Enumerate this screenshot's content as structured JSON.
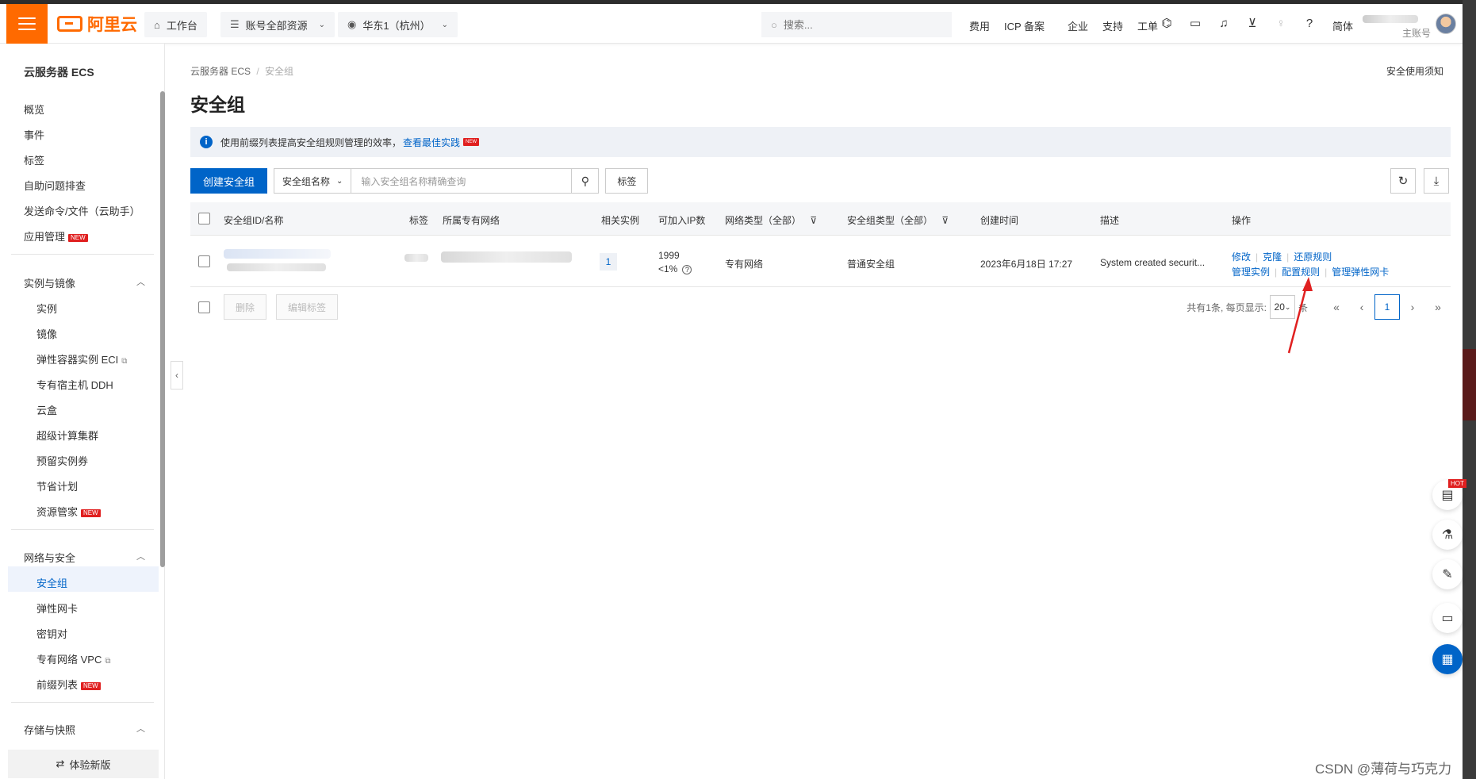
{
  "header": {
    "logo_text": "阿里云",
    "workbench": "工作台",
    "resources": "账号全部资源",
    "region": "华东1（杭州）",
    "search_placeholder": "搜索...",
    "nav": [
      "费用",
      "ICP 备案",
      "企业",
      "支持",
      "工单"
    ],
    "lang": "简体",
    "account_sub": "主账号"
  },
  "sidebar": {
    "title": "云服务器 ECS",
    "top_items": [
      "概览",
      "事件",
      "标签",
      "自助问题排查",
      "发送命令/文件（云助手）",
      "应用管理"
    ],
    "group1": {
      "label": "实例与镜像",
      "items": [
        "实例",
        "镜像",
        "弹性容器实例 ECI",
        "专有宿主机 DDH",
        "云盒",
        "超级计算集群",
        "预留实例券",
        "节省计划",
        "资源管家"
      ]
    },
    "group2": {
      "label": "网络与安全",
      "items": [
        "安全组",
        "弹性网卡",
        "密钥对",
        "专有网络 VPC",
        "前缀列表"
      ]
    },
    "group3": {
      "label": "存储与快照"
    },
    "new_badge": "NEW",
    "bottom": "体验新版"
  },
  "main": {
    "breadcrumb_root": "云服务器 ECS",
    "breadcrumb_sep": "/",
    "breadcrumb_current": "安全组",
    "notice_link": "安全使用须知",
    "title": "安全组",
    "info_text": "使用前缀列表提高安全组规则管理的效率，",
    "info_link": "查看最佳实践",
    "create_button": "创建安全组",
    "filter_select": "安全组名称",
    "filter_placeholder": "输入安全组名称精确查询",
    "tag_button": "标签",
    "columns": [
      "安全组ID/名称",
      "标签",
      "所属专有网络",
      "相关实例",
      "可加入IP数",
      "网络类型（全部）",
      "安全组类型（全部）",
      "创建时间",
      "描述",
      "操作"
    ],
    "row": {
      "instances": "1",
      "ip_count": "1999",
      "ip_pct": "<1%",
      "network_type": "专有网络",
      "sg_type": "普通安全组",
      "created": "2023年6月18日 17:27",
      "desc": "System created securit...",
      "actions_line1": [
        "修改",
        "克隆",
        "还原规则"
      ],
      "actions_line2": [
        "管理实例",
        "配置规则",
        "管理弹性网卡"
      ]
    },
    "delete_button": "删除",
    "edit_tags_button": "编辑标签",
    "pager_text": "共有1条, 每页显示:",
    "page_size": "20",
    "page_size_suffix": "条",
    "current_page": "1"
  },
  "floating": {
    "hot": "HOT"
  },
  "watermark": "CSDN @薄荷与巧克力",
  "colors": {
    "brand": "#ff6a00",
    "primary": "#0064c8",
    "annotation": "#e02020"
  }
}
